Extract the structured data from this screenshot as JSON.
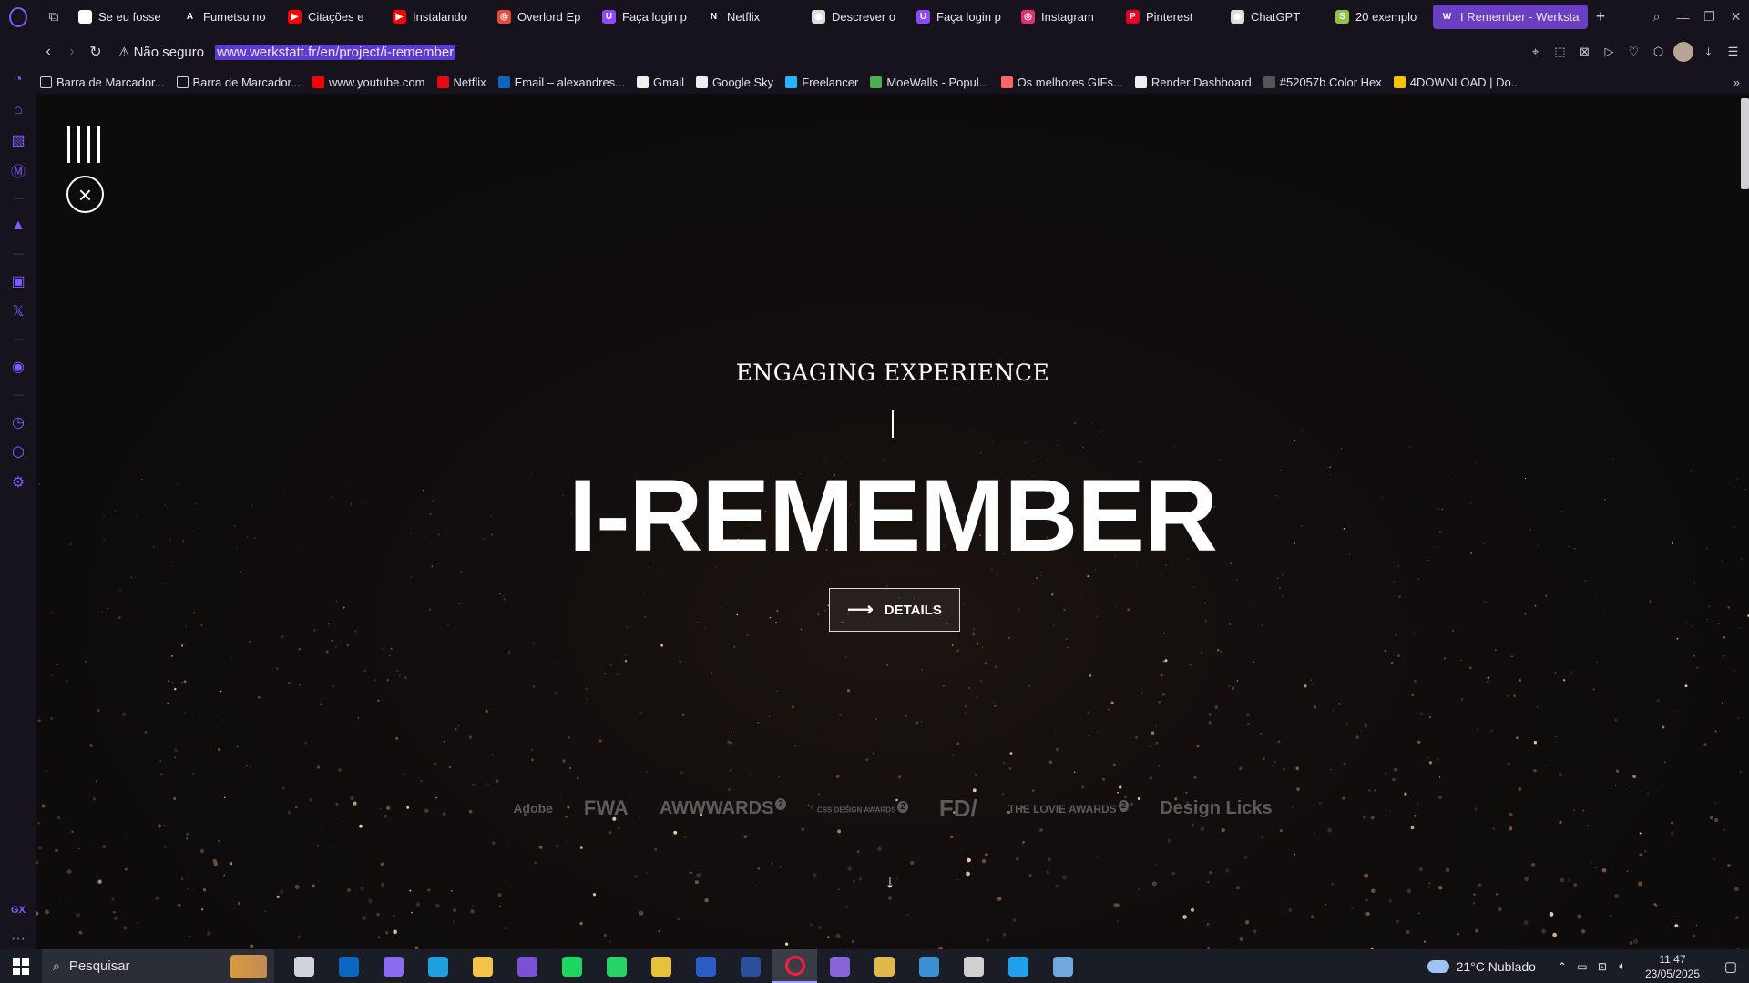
{
  "tabs": [
    {
      "label": "Se eu fosse",
      "color": "#ffffff",
      "glyph": "a"
    },
    {
      "label": "Fumetsu no",
      "color": "#16131c",
      "glyph": "A"
    },
    {
      "label": "Citações e",
      "color": "#ff0000",
      "glyph": "▶"
    },
    {
      "label": "Instalando",
      "color": "#ff0000",
      "glyph": "▶"
    },
    {
      "label": "Overlord Ep",
      "color": "#e74c3c",
      "glyph": "◎"
    },
    {
      "label": "Faça login p",
      "color": "#9146ff",
      "glyph": "U"
    },
    {
      "label": "Netflix",
      "color": "#16131c",
      "glyph": "N"
    },
    {
      "label": "Descrever o",
      "color": "#dddddd",
      "glyph": "◉"
    },
    {
      "label": "Faça login p",
      "color": "#9146ff",
      "glyph": "U"
    },
    {
      "label": "Instagram",
      "color": "#e1306c",
      "glyph": "◎"
    },
    {
      "label": "Pinterest",
      "color": "#e60023",
      "glyph": "P"
    },
    {
      "label": "ChatGPT",
      "color": "#dddddd",
      "glyph": "◉"
    },
    {
      "label": "20 exemplo",
      "color": "#95bf47",
      "glyph": "S"
    },
    {
      "label": "I Remember - Werksta",
      "color": "#6a3fc4",
      "glyph": "W"
    }
  ],
  "address": {
    "security": "Não seguro",
    "url": "www.werkstatt.fr/en/project/i-remember"
  },
  "bookmarks": [
    {
      "label": "Barra de Marcador...",
      "color": "#16131c"
    },
    {
      "label": "Barra de Marcador...",
      "color": "#16131c"
    },
    {
      "label": "www.youtube.com",
      "color": "#ff0000"
    },
    {
      "label": "Netflix",
      "color": "#e50914"
    },
    {
      "label": "Email – alexandres...",
      "color": "#0a66c2"
    },
    {
      "label": "Gmail",
      "color": "#eeeeee"
    },
    {
      "label": "Google Sky",
      "color": "#eeeeee"
    },
    {
      "label": "Freelancer",
      "color": "#29b2fe"
    },
    {
      "label": "MoeWalls - Popul...",
      "color": "#4caf50"
    },
    {
      "label": "Os melhores GIFs...",
      "color": "#ff6666"
    },
    {
      "label": "Render Dashboard",
      "color": "#eeeeee"
    },
    {
      "label": "#52057b Color Hex",
      "color": "#555555"
    },
    {
      "label": "4DOWNLOAD | Do...",
      "color": "#f5c400"
    }
  ],
  "page": {
    "eyebrow": "ENGAGING EXPERIENCE",
    "title": "I-REMEMBER",
    "details_label": "DETAILS",
    "awards": [
      {
        "label": "Adobe",
        "size": "14px"
      },
      {
        "label": "FWA",
        "size": "22px"
      },
      {
        "label": "AWWWARDS",
        "size": "20px",
        "sup": "2"
      },
      {
        "label": "CSS DESIGN AWARDS",
        "size": "8px",
        "sup": "2"
      },
      {
        "label": "FD/",
        "size": "26px"
      },
      {
        "label": "THE LOVIE AWARDS",
        "size": "12px",
        "sup": "2"
      },
      {
        "label": "Design Licks",
        "size": "20px"
      }
    ]
  },
  "taskbar": {
    "search_placeholder": "Pesquisar",
    "apps": [
      {
        "name": "task-view",
        "color": "#cfd3dc"
      },
      {
        "name": "outlook",
        "color": "#0a66c2"
      },
      {
        "name": "copilot",
        "color": "#8a6cf0"
      },
      {
        "name": "edge",
        "color": "#1fa0e0"
      },
      {
        "name": "file-explorer",
        "color": "#f5c24a"
      },
      {
        "name": "github-desktop",
        "color": "#7b4fd6"
      },
      {
        "name": "spotify",
        "color": "#1ed760"
      },
      {
        "name": "whatsapp",
        "color": "#25d366"
      },
      {
        "name": "image-editor",
        "color": "#e6c23c"
      },
      {
        "name": "word",
        "color": "#2b5cc8"
      },
      {
        "name": "app-blue",
        "color": "#2a4f9c"
      },
      {
        "name": "opera-gx",
        "color": "#ff1b3d"
      },
      {
        "name": "visual-studio",
        "color": "#8663d8"
      },
      {
        "name": "book-app",
        "color": "#e0b84c"
      },
      {
        "name": "shield-app",
        "color": "#3c8fd0"
      },
      {
        "name": "dark-app",
        "color": "#d0d0d0"
      },
      {
        "name": "vscode",
        "color": "#22a0f0"
      },
      {
        "name": "remote-app",
        "color": "#6fa8dc"
      }
    ],
    "weather": "21°C  Nublado",
    "time": "11:47",
    "date": "23/05/2025"
  }
}
